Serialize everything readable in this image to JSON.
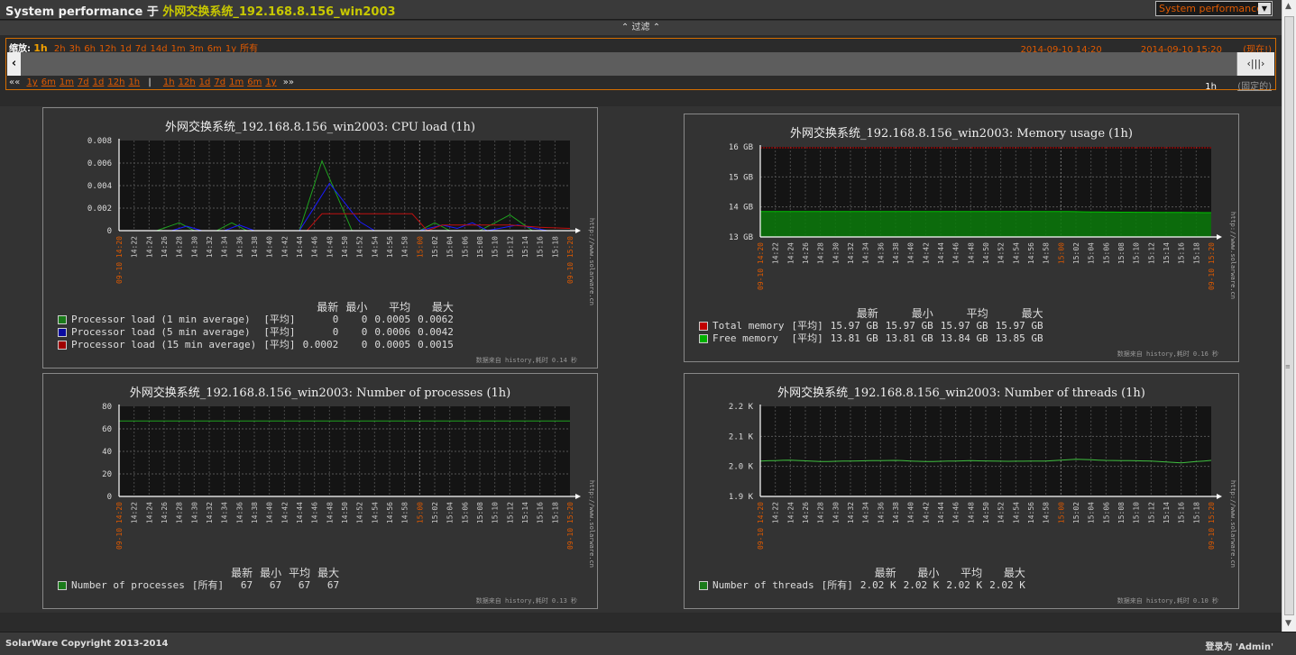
{
  "header": {
    "title": "System performance",
    "conj": "于",
    "host": "外网交换系统_192.168.8.156_win2003",
    "select_value": "System performance"
  },
  "filter": {
    "label": "过滤"
  },
  "timeline": {
    "zoom_label": "缩放:",
    "zoom_current": "1h",
    "zoom_links": [
      "2h",
      "3h",
      "6h",
      "12h",
      "1d",
      "7d",
      "14d",
      "1m",
      "3m",
      "6m",
      "1y",
      "所有"
    ],
    "date_from": "2014-09-10 14:20",
    "date_to": "2014-09-10 15:20",
    "date_to_note": "(现在!)",
    "nav_back_label": "««",
    "nav_back": [
      "1y",
      "6m",
      "1m",
      "7d",
      "1d",
      "12h",
      "1h"
    ],
    "nav_sep": "|",
    "nav_fwd": [
      "1h",
      "12h",
      "1d",
      "7d",
      "1m",
      "6m",
      "1y"
    ],
    "nav_fwd_label": "»»",
    "period": "1h",
    "fixed": "(固定的)"
  },
  "time_ticks": [
    "14:22",
    "14:24",
    "14:26",
    "14:28",
    "14:30",
    "14:32",
    "14:34",
    "14:36",
    "14:38",
    "14:40",
    "14:42",
    "14:44",
    "14:46",
    "14:48",
    "14:50",
    "14:52",
    "14:54",
    "14:56",
    "14:58",
    "15:00",
    "15:02",
    "15:04",
    "15:06",
    "15:08",
    "15:10",
    "15:12",
    "15:14",
    "15:16",
    "15:18"
  ],
  "time_start": "09-10 14:20",
  "time_end": "09-10 15:20",
  "hour_mark": "15:00",
  "watermark": "http://www.solarware.cn",
  "graphs": {
    "cpu": {
      "title": "外网交换系统_192.168.8.156_win2003: CPU load (1h)",
      "y_ticks": [
        "0.008",
        "0.006",
        "0.004",
        "0.002",
        "0"
      ],
      "headers": [
        "最新",
        "最小",
        "平均",
        "最大"
      ],
      "rows": [
        {
          "color": "#1a7a1a",
          "name": "Processor load (1 min average)",
          "func": "[平均]",
          "vals": [
            "0",
            "0",
            "0.0005",
            "0.0062"
          ]
        },
        {
          "color": "#0a0aa0",
          "name": "Processor load (5 min average)",
          "func": "[平均]",
          "vals": [
            "0",
            "0",
            "0.0006",
            "0.0042"
          ]
        },
        {
          "color": "#a00000",
          "name": "Processor load (15 min average)",
          "func": "[平均]",
          "vals": [
            "0.0002",
            "0",
            "0.0005",
            "0.0015"
          ]
        }
      ],
      "footer": "数据来自 history,耗时 0.14 秒"
    },
    "memory": {
      "title": "外网交换系统_192.168.8.156_win2003: Memory usage (1h)",
      "y_ticks": [
        "16 GB",
        "15 GB",
        "14 GB",
        "13 GB"
      ],
      "headers": [
        "最新",
        "最小",
        "平均",
        "最大"
      ],
      "rows": [
        {
          "color": "#c00000",
          "name": "Total memory",
          "func": "[平均]",
          "vals": [
            "15.97 GB",
            "15.97 GB",
            "15.97 GB",
            "15.97 GB"
          ]
        },
        {
          "color": "#00b000",
          "name": "Free memory",
          "func": "[平均]",
          "vals": [
            "13.81 GB",
            "13.81 GB",
            "13.84 GB",
            "13.85 GB"
          ]
        }
      ],
      "footer": "数据来自 history,耗时 0.16 秒"
    },
    "processes": {
      "title": "外网交换系统_192.168.8.156_win2003: Number of processes (1h)",
      "y_ticks": [
        "80",
        "60",
        "40",
        "20",
        "0"
      ],
      "headers": [
        "最新",
        "最小",
        "平均",
        "最大"
      ],
      "rows": [
        {
          "color": "#1a7a1a",
          "name": "Number of processes",
          "func": "[所有]",
          "vals": [
            "67",
            "67",
            "67",
            "67"
          ]
        }
      ],
      "footer": "数据来自 history,耗时 0.13 秒"
    },
    "threads": {
      "title": "外网交换系统_192.168.8.156_win2003: Number of threads (1h)",
      "y_ticks": [
        "2.2 K",
        "2.1 K",
        "2.0 K",
        "1.9 K"
      ],
      "headers": [
        "最新",
        "最小",
        "平均",
        "最大"
      ],
      "rows": [
        {
          "color": "#1a7a1a",
          "name": "Number of threads",
          "func": "[所有]",
          "vals": [
            "2.02 K",
            "2.02 K",
            "2.02 K",
            "2.02 K"
          ]
        }
      ],
      "footer": "数据来自 history,耗时 0.10 秒"
    }
  },
  "footer": {
    "copyright": "SolarWare Copyright 2013-2014",
    "login": "登录为 'Admin'"
  }
}
